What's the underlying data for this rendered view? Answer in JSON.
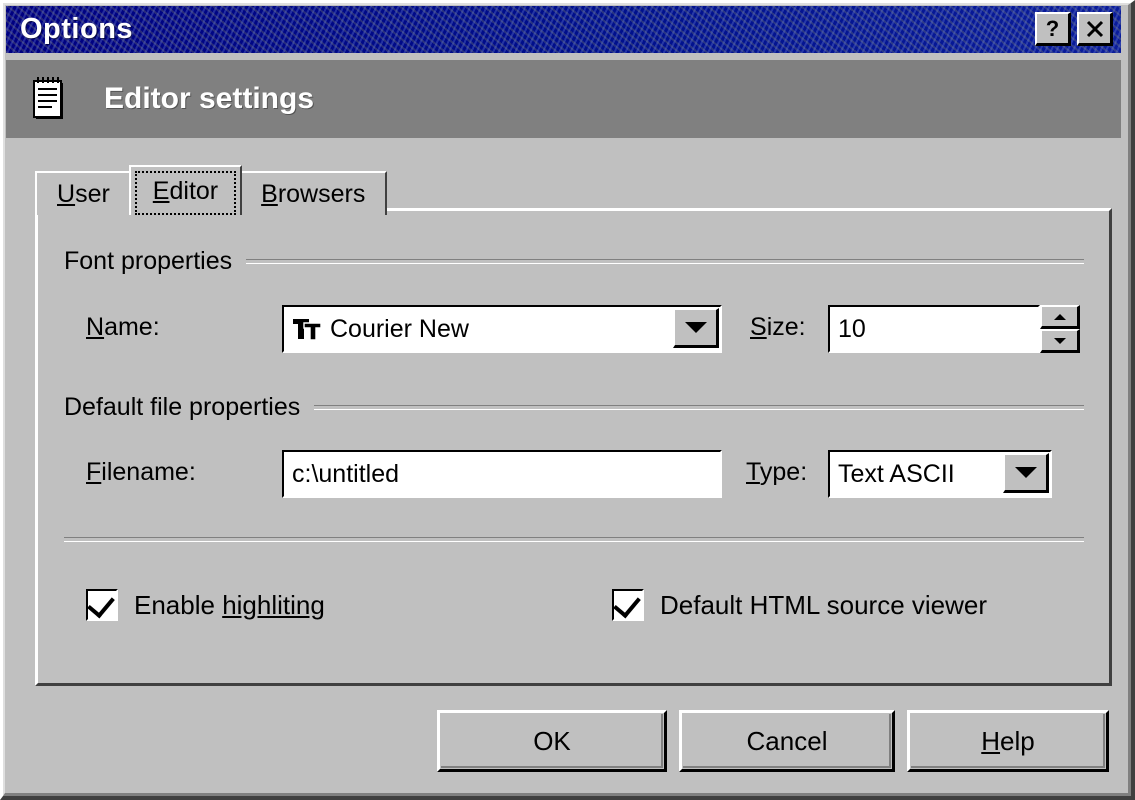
{
  "window": {
    "title": "Options",
    "help_button": "?",
    "close_button": "×"
  },
  "header": {
    "title": "Editor settings",
    "icon": "notepad-icon"
  },
  "tabs": [
    {
      "label_before": "",
      "accel": "U",
      "label_after": "ser",
      "full": "User",
      "active": false
    },
    {
      "label_before": "",
      "accel": "E",
      "label_after": "ditor",
      "full": "Editor",
      "active": true
    },
    {
      "label_before": "",
      "accel": "B",
      "label_after": "rowsers",
      "full": "Browsers",
      "active": false
    }
  ],
  "font_group": {
    "title": "Font properties",
    "name_label_before": "",
    "name_accel": "N",
    "name_label_after": "ame:",
    "name_full": "Name:",
    "font_value": "Courier New",
    "font_icon": "truetype-icon",
    "size_label_before": "",
    "size_accel": "S",
    "size_label_after": "ize:",
    "size_full": "Size:",
    "size_value": "10"
  },
  "file_group": {
    "title": "Default file properties",
    "filename_label_before": "",
    "filename_accel": "F",
    "filename_label_after": "ilename:",
    "filename_full": "Filename:",
    "filename_value": "c:\\untitled",
    "type_label_before": "",
    "type_accel": "T",
    "type_label_after": "ype:",
    "type_full": "Type:",
    "type_value": "Text ASCII"
  },
  "checkboxes": [
    {
      "label_before": "Enable ",
      "accel": "highliting",
      "label_after": "",
      "full": "Enable highliting",
      "checked": true
    },
    {
      "label_before": "Default HTML source viewer",
      "accel": "",
      "label_after": "",
      "full": "Default HTML source viewer",
      "checked": true
    }
  ],
  "buttons": [
    {
      "label_before": "OK",
      "accel": "",
      "label_after": "",
      "full": "OK"
    },
    {
      "label_before": "Cancel",
      "accel": "",
      "label_after": "",
      "full": "Cancel"
    },
    {
      "label_before": "",
      "accel": "H",
      "label_after": "elp",
      "full": "Help"
    }
  ],
  "colors": {
    "dialog_face": "#c0c0c0",
    "titlebar": "#000080",
    "header_band": "#808080",
    "titlebar_text": "#ffffff",
    "field_bg": "#ffffff",
    "text": "#000000"
  }
}
